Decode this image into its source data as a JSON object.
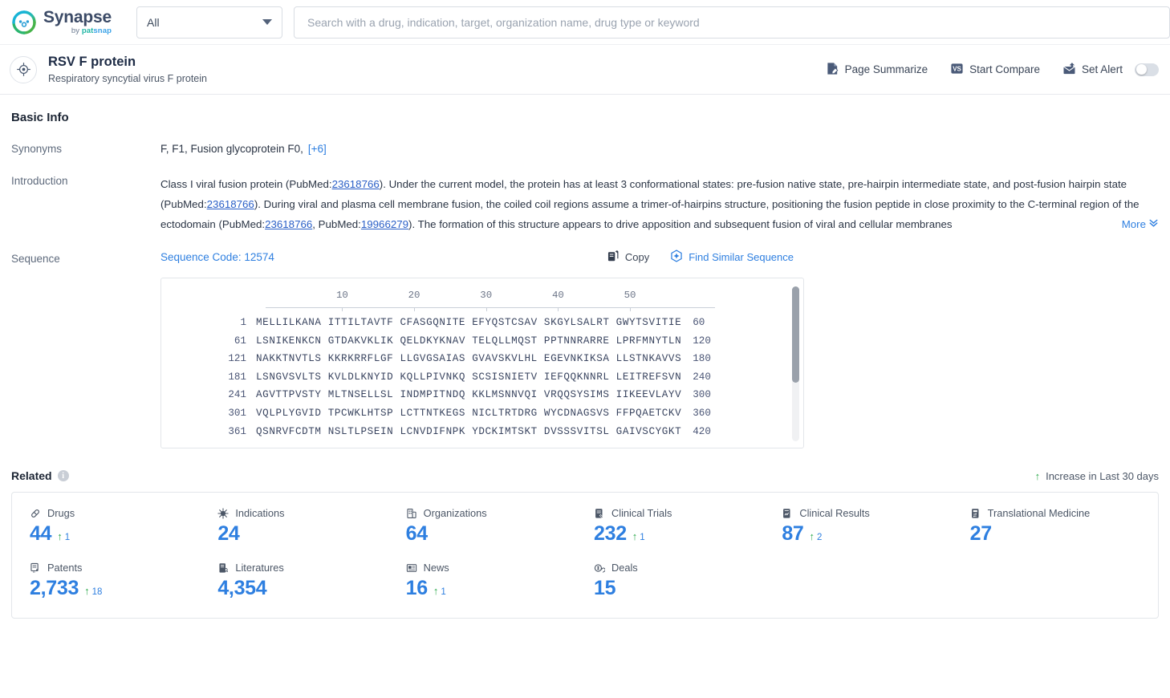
{
  "topbar": {
    "brand_name": "Synapse",
    "brand_by": "by ",
    "brand_pat": "pat",
    "brand_snap": "snap",
    "scope_value": "All",
    "search_placeholder": "Search with a drug, indication, target, organization name, drug type or keyword",
    "search_value": ""
  },
  "entity": {
    "title": "RSV F protein",
    "subtitle": "Respiratory syncytial virus F protein",
    "actions": [
      {
        "label": "Page Summarize",
        "icon": "page-summarize-icon"
      },
      {
        "label": "Start Compare",
        "icon": "versus-icon"
      },
      {
        "label": "Set Alert",
        "icon": "alert-envelope-icon"
      }
    ],
    "alert_enabled": false
  },
  "basic_info": {
    "heading": "Basic Info",
    "synonyms_label": "Synonyms",
    "synonyms": "F,  F1,  Fusion glycoprotein F0,",
    "synonyms_more": "[+6]",
    "introduction_label": "Introduction",
    "introduction_parts": [
      {
        "t": "Class I viral fusion protein (PubMed:",
        "link": false
      },
      {
        "t": "23618766",
        "link": true
      },
      {
        "t": "). Under the current model, the protein has at least 3 conformational states: pre-fusion native state, pre-hairpin intermediate state, and post-fusion hairpin state (PubMed:",
        "link": false
      },
      {
        "t": "23618766",
        "link": true
      },
      {
        "t": "). During viral and plasma cell membrane fusion, the coiled coil regions assume a trimer-of-hairpins structure, positioning the fusion peptide in close proximity to the C-terminal region of the ectodomain (PubMed:",
        "link": false
      },
      {
        "t": "23618766",
        "link": true
      },
      {
        "t": ", PubMed:",
        "link": false
      },
      {
        "t": "19966279",
        "link": true
      },
      {
        "t": "). The formation of this structure appears to drive apposition and subsequent fusion of viral and cellular membranes",
        "link": false
      }
    ],
    "more_label": "More"
  },
  "sequence": {
    "label": "Sequence",
    "code_label": "Sequence Code: 12574",
    "copy_label": "Copy",
    "find_similar_label": "Find Similar Sequence",
    "ruler_ticks": [
      10,
      20,
      30,
      40,
      50
    ],
    "rows": [
      {
        "start": "1",
        "residues": "MELLILKANA ITTILTAVTF CFASGQNITE EFYQSTCSAV SKGYLSALRT GWYTSVITIE",
        "end": "60"
      },
      {
        "start": "61",
        "residues": "LSNIKENKCN GTDAKVKLIK QELDKYKNAV TELQLLMQST PPTNNRARRE LPRFMNYTLN",
        "end": "120"
      },
      {
        "start": "121",
        "residues": "NAKKTNVTLS KKRKRRFLGF LLGVGSAIAS GVAVSKVLHL EGEVNKIKSA LLSTNKAVVS",
        "end": "180"
      },
      {
        "start": "181",
        "residues": "LSNGVSVLTS KVLDLKNYID KQLLPIVNKQ SCSISNIETV IEFQQKNNRL LEITREFSVN",
        "end": "240"
      },
      {
        "start": "241",
        "residues": "AGVTTPVSTY MLTNSELLSL INDMPITNDQ KKLMSNNVQI VRQQSYSIMS IIKEEVLAYV",
        "end": "300"
      },
      {
        "start": "301",
        "residues": "VQLPLYGVID TPCWKLHTSP LCTTNTKEGS NICLTRTDRG WYCDNAGSVS FFPQAETCKV",
        "end": "360"
      },
      {
        "start": "361",
        "residues": "QSNRVFCDTM NSLTLPSEIN LCNVDIFNPK YDCKIMTSKT DVSSSVITSL GAIVSCYGKT",
        "end": "420"
      }
    ]
  },
  "related": {
    "heading": "Related",
    "info_glyph": "i",
    "legend_label": "Increase in Last 30 days",
    "legend_arrow": "↑",
    "stats": [
      {
        "label": "Drugs",
        "icon": "pill-icon",
        "value": "44",
        "delta": "1"
      },
      {
        "label": "Indications",
        "icon": "virus-icon",
        "value": "24",
        "delta": ""
      },
      {
        "label": "Organizations",
        "icon": "building-icon",
        "value": "64",
        "delta": ""
      },
      {
        "label": "Clinical Trials",
        "icon": "clinical-trial-icon",
        "value": "232",
        "delta": "1"
      },
      {
        "label": "Clinical Results",
        "icon": "clinical-result-icon",
        "value": "87",
        "delta": "2"
      },
      {
        "label": "Translational Medicine",
        "icon": "translational-icon",
        "value": "27",
        "delta": ""
      },
      {
        "label": "Patents",
        "icon": "patent-icon",
        "value": "2,733",
        "delta": "18"
      },
      {
        "label": "Literatures",
        "icon": "literature-icon",
        "value": "4,354",
        "delta": ""
      },
      {
        "label": "News",
        "icon": "news-icon",
        "value": "16",
        "delta": "1"
      },
      {
        "label": "Deals",
        "icon": "deal-icon",
        "value": "15",
        "delta": ""
      }
    ]
  },
  "colors": {
    "accent_blue": "#2e7fe0",
    "increase_green": "#2faa4e",
    "text_dark": "#1b2433"
  }
}
